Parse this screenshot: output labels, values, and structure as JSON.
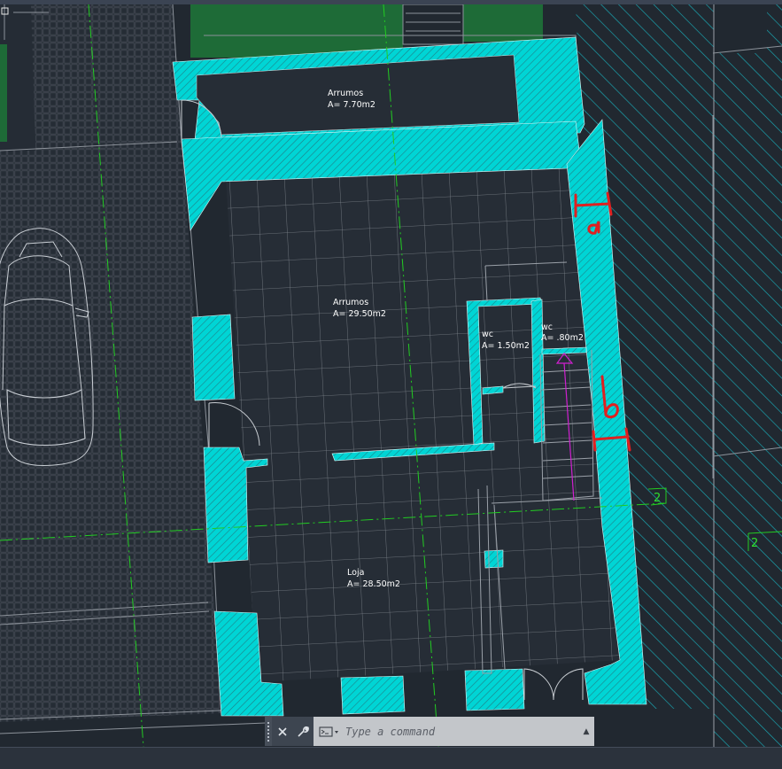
{
  "drawing": {
    "rooms": [
      {
        "name": "Arrumos",
        "area": "A= 7.70m2"
      },
      {
        "name": "Arrumos",
        "area": "A= 29.50m2"
      },
      {
        "name": "wc",
        "area": "A= 1.50m2"
      },
      {
        "name": "wc",
        "area": "A= .80m2"
      },
      {
        "name": "Loja",
        "area": "A= 28.50m2"
      }
    ],
    "grid_labels": [
      "2",
      "2"
    ],
    "markups": [
      "a",
      "b"
    ],
    "colors": {
      "background": "#212830",
      "wall_fill": "#00d5d5",
      "grass": "#1e6b37",
      "grid_axis": "#22cc22",
      "markup": "#e02020",
      "stair_arrow": "#d020d0",
      "linework": "#8c929a"
    }
  },
  "command_line": {
    "placeholder": "Type a command",
    "icons": {
      "close": "close-icon",
      "customize": "wrench-icon",
      "prompt": "command-prompt-icon",
      "history": "chevron-up-icon"
    }
  }
}
